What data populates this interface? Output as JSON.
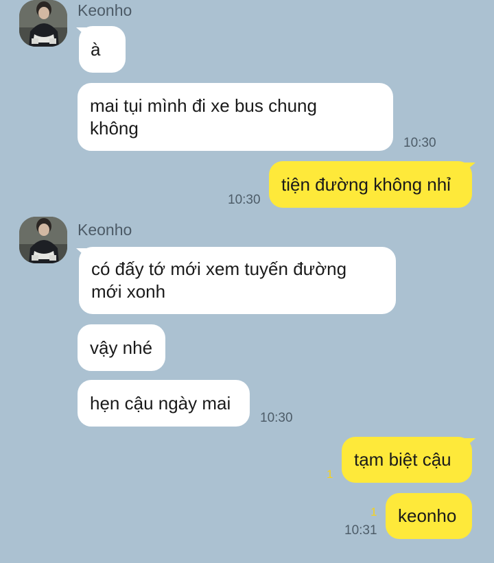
{
  "messages": [
    {
      "sender": "Keonho",
      "text": "à"
    },
    {
      "text_line1": "mai tụi mình đi xe bus chung",
      "text_line2": "không",
      "time": "10:30"
    },
    {
      "text": "tiện đường không nhỉ",
      "time": "10:30"
    },
    {
      "sender": "Keonho",
      "text_line1": "có đấy tớ mới xem tuyến đường",
      "text_line2": "mới xonh"
    },
    {
      "text": "vậy nhé"
    },
    {
      "text": "hẹn cậu ngày mai",
      "time": "10:30"
    },
    {
      "text": "tạm biệt cậu",
      "unread": "1"
    },
    {
      "text": "keonho",
      "unread": "1",
      "time": "10:31"
    }
  ],
  "colors": {
    "background": "#abc1d1",
    "incoming_bubble": "#ffffff",
    "outgoing_bubble": "#fee93a",
    "unread_count": "#f6d21c"
  },
  "icons": {
    "avatar": "profile-photo"
  }
}
